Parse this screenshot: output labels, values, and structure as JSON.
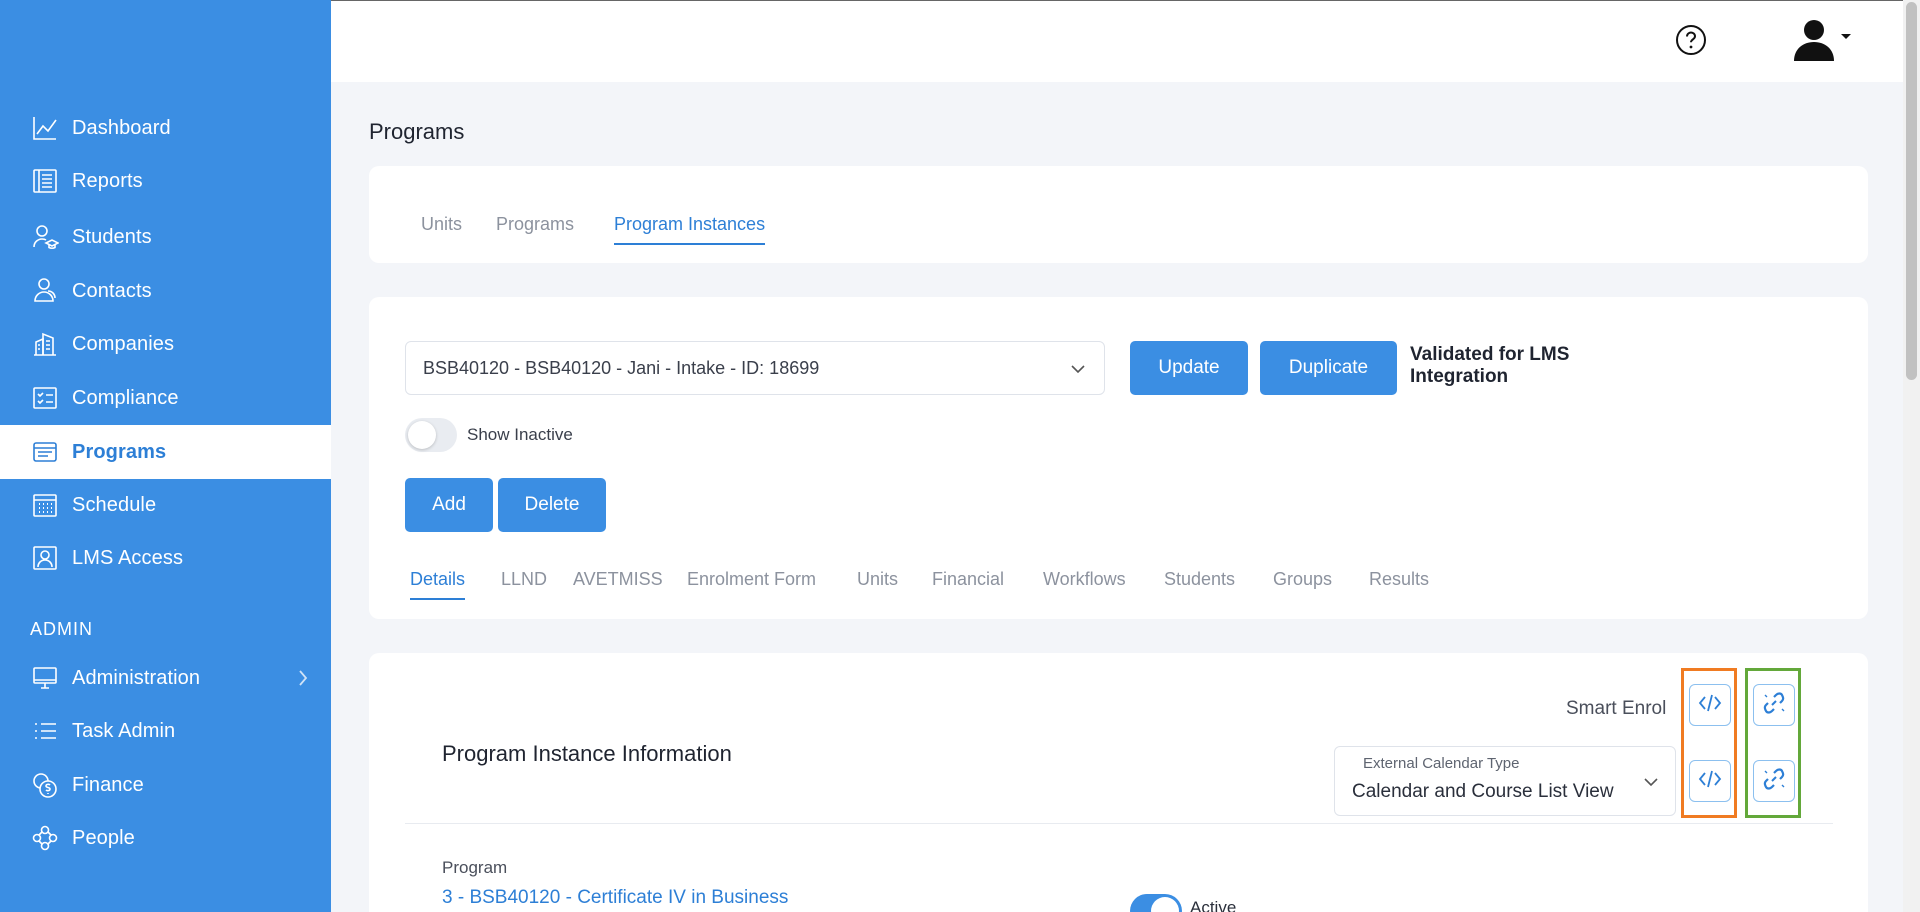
{
  "sidebar": {
    "items": [
      {
        "label": "Dashboard",
        "icon": "chart-line-icon"
      },
      {
        "label": "Reports",
        "icon": "report-icon"
      },
      {
        "label": "Students",
        "icon": "student-icon"
      },
      {
        "label": "Contacts",
        "icon": "contacts-icon"
      },
      {
        "label": "Companies",
        "icon": "building-icon"
      },
      {
        "label": "Compliance",
        "icon": "checklist-icon"
      },
      {
        "label": "Programs",
        "icon": "browser-window-icon"
      },
      {
        "label": "Schedule",
        "icon": "calendar-icon"
      },
      {
        "label": "LMS Access",
        "icon": "user-monitor-icon"
      }
    ],
    "admin_label": "ADMIN",
    "admin_items": [
      {
        "label": "Administration",
        "icon": "desktop-icon"
      },
      {
        "label": "Task Admin",
        "icon": "list-icon"
      },
      {
        "label": "Finance",
        "icon": "coins-icon"
      },
      {
        "label": "People",
        "icon": "people-icon"
      }
    ]
  },
  "header": {
    "help_icon": "help-circle-icon",
    "user_icon": "user-avatar-icon"
  },
  "page": {
    "title": "Programs",
    "tabs": [
      "Units",
      "Programs",
      "Program Instances"
    ],
    "active_tab": "Program Instances"
  },
  "instance": {
    "selected": "BSB40120 - BSB40120 - Jani - Intake - ID: 18699",
    "update_label": "Update",
    "duplicate_label": "Duplicate",
    "validated_text": "Validated for LMS Integration",
    "show_inactive_label": "Show Inactive",
    "add_label": "Add",
    "delete_label": "Delete",
    "subtabs": [
      "Details",
      "LLND",
      "AVETMISS",
      "Enrolment Form",
      "Units",
      "Financial",
      "Workflows",
      "Students",
      "Groups",
      "Results"
    ],
    "active_subtab": "Details"
  },
  "info": {
    "title": "Program Instance Information",
    "smart_enrol_label": "Smart Enrol",
    "calendar_caption": "External Calendar Type",
    "calendar_value": "Calendar and Course List View",
    "program_label": "Program",
    "program_value": "3 - BSB40120 - Certificate IV in Business",
    "active_label": "Active"
  },
  "colors": {
    "sidebar": "#3b8ee3",
    "accent": "#2d7fd6",
    "highlight_orange": "#f07b22",
    "highlight_green": "#63a83a"
  }
}
